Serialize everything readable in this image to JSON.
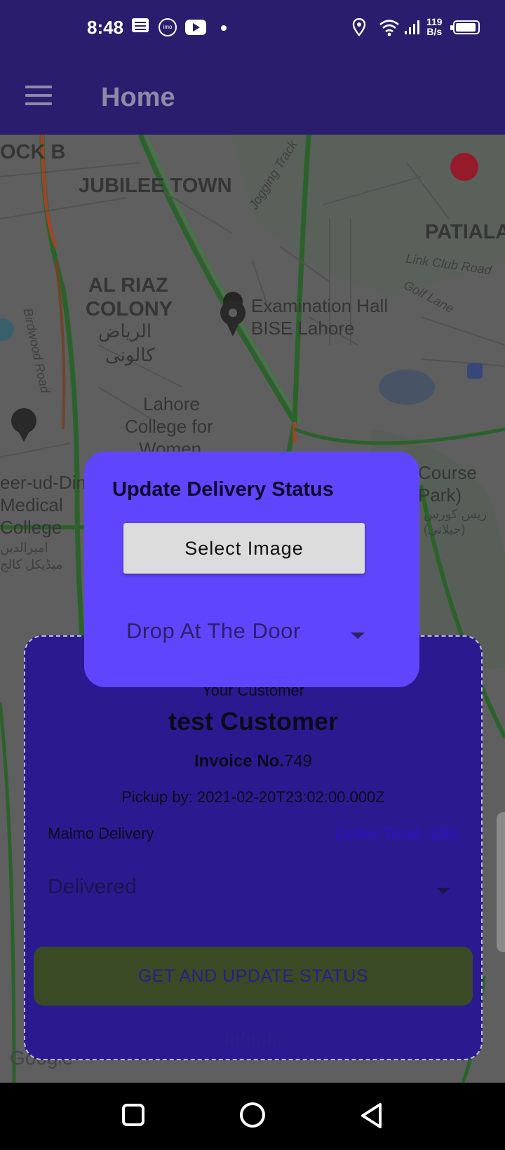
{
  "status_bar": {
    "time": "8:48",
    "net_speed_value": "119",
    "net_speed_unit": "B/s",
    "imo_label": "imo",
    "icons": [
      "message-icon",
      "imo-icon",
      "youtube-icon",
      "notification-dot-icon",
      "location-icon",
      "wifi-icon",
      "signal-icon",
      "battery-icon"
    ]
  },
  "app_bar": {
    "title": "Home",
    "menu_icon": "hamburger-menu-icon"
  },
  "map": {
    "labels": {
      "block_b": "OCK B",
      "jubilee_town": "JUBILEE TOWN",
      "jogging_track": "Jogging Track",
      "patiala": "PATIALA",
      "link_club_road": "Link Club Road",
      "golf_lane": "Golf Lane",
      "al_riaz_1": "AL RIAZ",
      "al_riaz_2": "COLONY",
      "al_riaz_ur_1": "الریاض",
      "al_riaz_ur_2": "کالونی",
      "exam_hall_1": "Examination Hall",
      "exam_hall_2": "BISE Lahore",
      "birdwood_road": "Birdwood Road",
      "lahore_college_1": "Lahore",
      "lahore_college_2": "College for",
      "lahore_college_3": "Women",
      "ameer_1": "eer-ud-Din",
      "ameer_2": "Medical",
      "ameer_3": "College",
      "ameer_ur_1": "امیرالدین",
      "ameer_ur_2": "میڈیکل کالج",
      "race_course_1": "Course",
      "race_course_2": "Park)",
      "race_course_ur_1": "ریس کورس",
      "race_course_ur_2": "(جیلانی)",
      "google": "Google"
    }
  },
  "dialog": {
    "title": "Update Delivery Status",
    "select_image_label": "Select Image",
    "drop_option": "Drop At The Door"
  },
  "card": {
    "customer_label": "Your Customer",
    "customer_name": "test Customer",
    "invoice_label": "Invoice No.",
    "invoice_number": "749",
    "pickup_text": "Pickup by: 2021-02-20T23:02:00.000Z",
    "company": "Malmo Delivery",
    "order_total": "Order Total :250",
    "status_value": "Delivered",
    "update_button": "GET AND UPDATE STATUS",
    "footer_text": "fgfggfg"
  },
  "colors": {
    "app_bar": "#2a1d6e",
    "dialog": "#5f46fd",
    "card": "#2b1a8f",
    "button": "#3a4a24"
  }
}
